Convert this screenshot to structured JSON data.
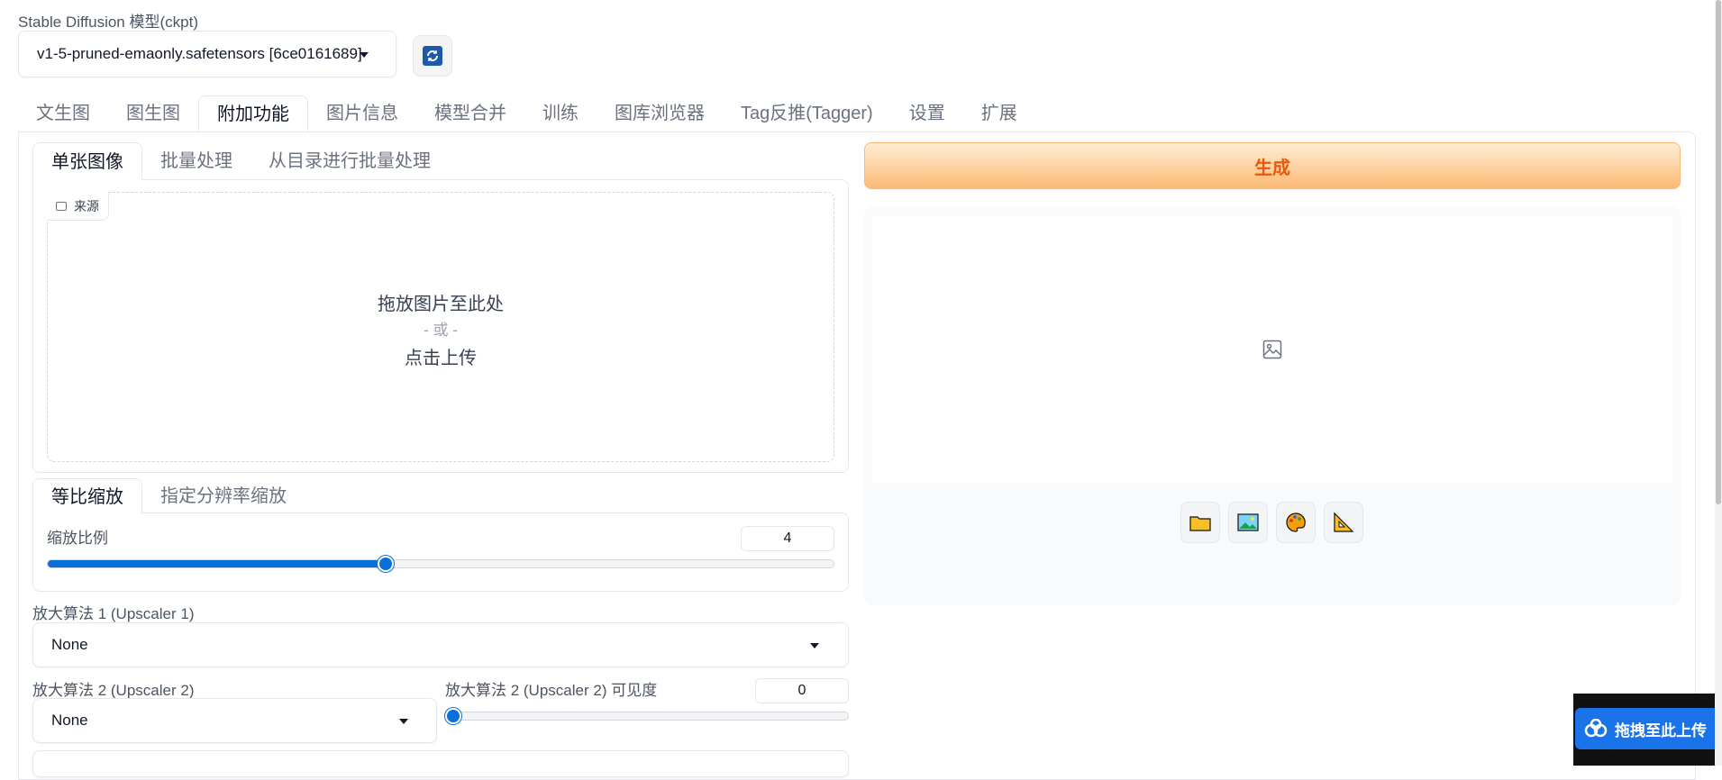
{
  "model": {
    "label": "Stable Diffusion 模型(ckpt)",
    "selected": "v1-5-pruned-emaonly.safetensors [6ce0161689]",
    "refresh_icon": "refresh-icon"
  },
  "main_tabs": [
    "文生图",
    "图生图",
    "附加功能",
    "图片信息",
    "模型合并",
    "训练",
    "图库浏览器",
    "Tag反推(Tagger)",
    "设置",
    "扩展"
  ],
  "main_tab_active": "附加功能",
  "sub_tabs": [
    "单张图像",
    "批量处理",
    "从目录进行批量处理"
  ],
  "upload": {
    "source_label": "来源",
    "drop_text": "拖放图片至此处",
    "or_text": "- 或 -",
    "click_text": "点击上传"
  },
  "scale_tabs": [
    "等比缩放",
    "指定分辨率缩放"
  ],
  "resize": {
    "label": "缩放比例",
    "value": "4",
    "slider_fraction": 0.43
  },
  "upscaler1": {
    "label": "放大算法 1 (Upscaler 1)",
    "value": "None"
  },
  "upscaler2": {
    "label": "放大算法 2 (Upscaler 2)",
    "value": "None"
  },
  "upscaler2_visibility": {
    "label": "放大算法 2 (Upscaler 2) 可见度",
    "value": "0",
    "slider_fraction": 0
  },
  "generate_label": "生成",
  "tool_icons": [
    "folder-icon",
    "picture-icon",
    "palette-icon",
    "triangle-ruler-icon"
  ],
  "baidu_badge": {
    "text": "拖拽至此上传"
  },
  "colors": {
    "accent": "#0b6fd9",
    "generate_text": "#ea580c",
    "generate_bg": "#fdba74"
  }
}
